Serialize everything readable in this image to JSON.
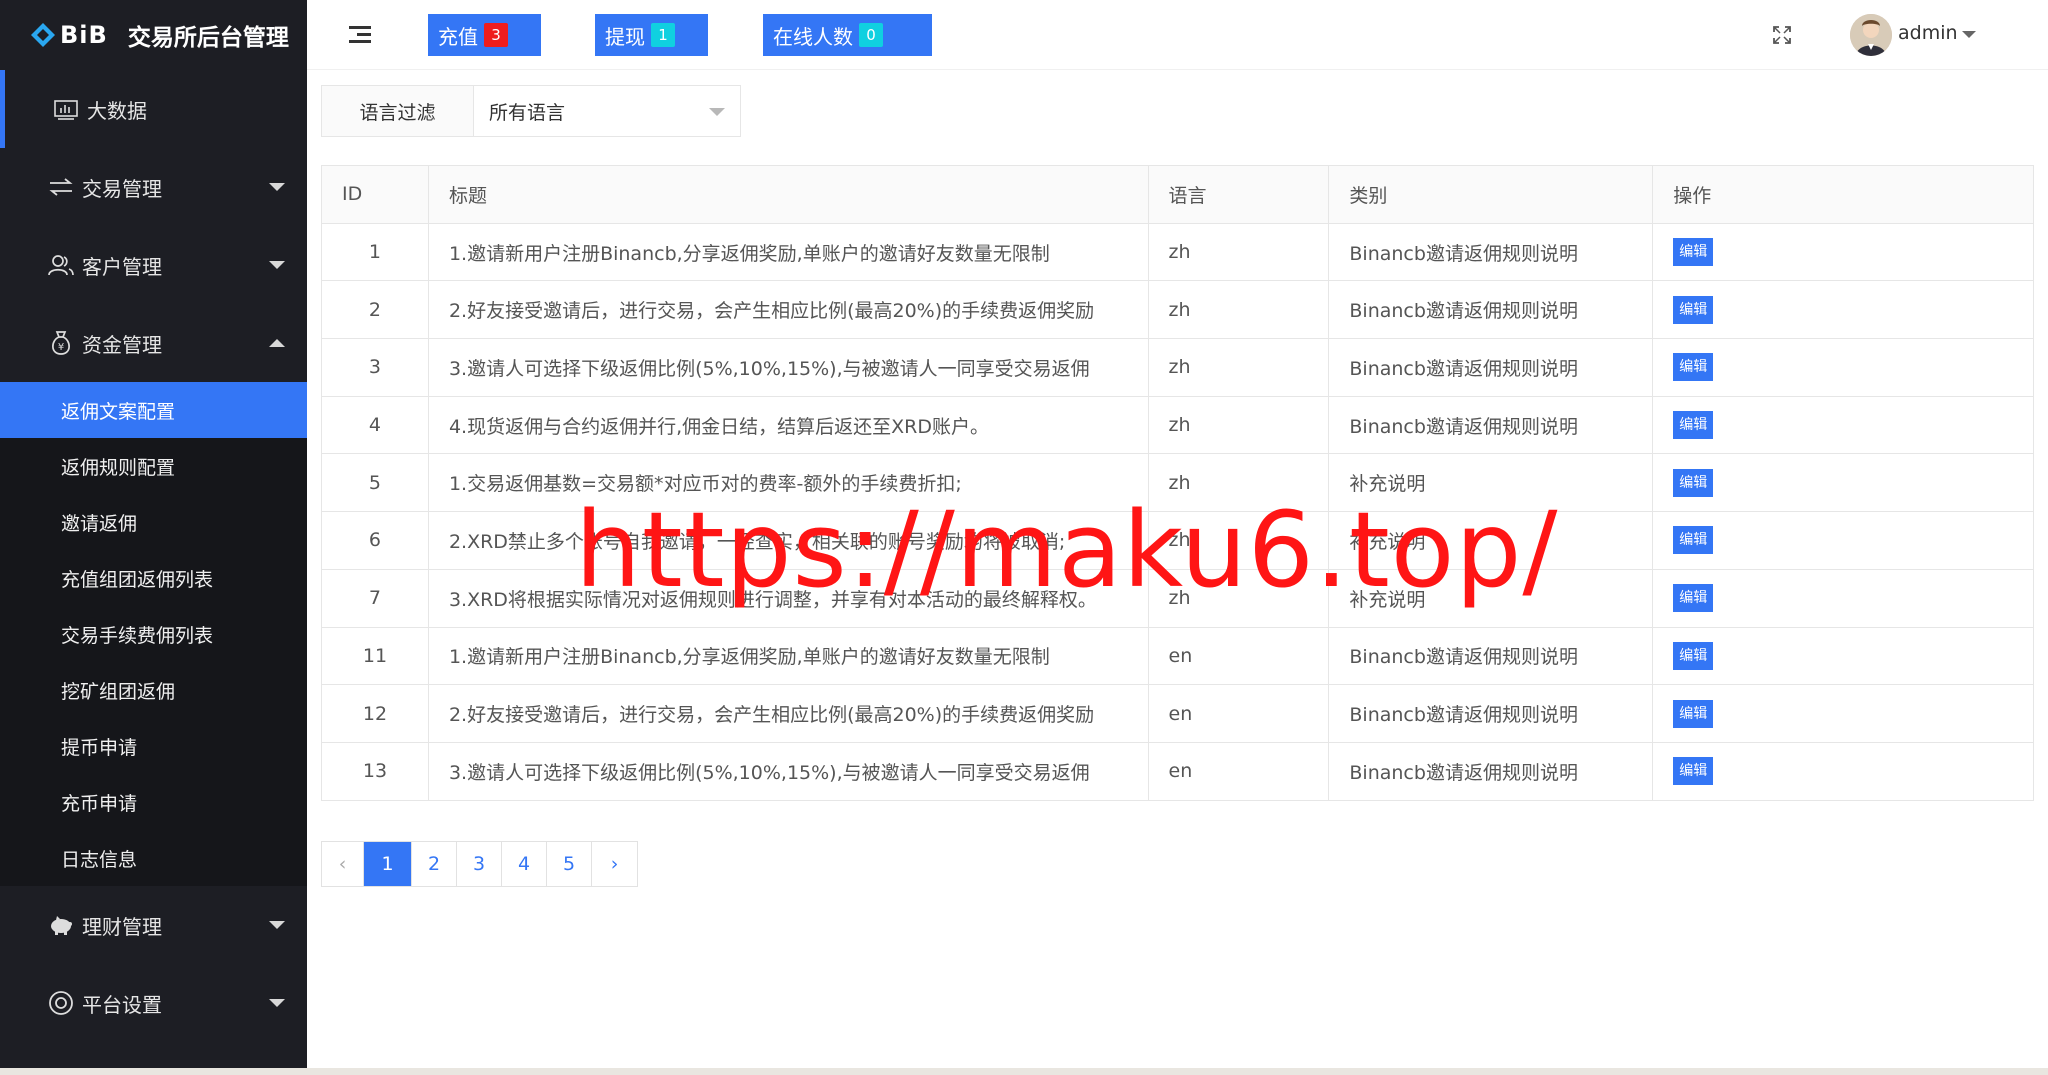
{
  "brand": {
    "logo_text": "BiB",
    "title": "交易所后台管理"
  },
  "sidebar": {
    "top_item": {
      "label": "大数据",
      "icon": "monitor-chart-icon"
    },
    "groups": [
      {
        "label": "交易管理",
        "icon": "exchange-arrows-icon",
        "expanded": false
      },
      {
        "label": "客户管理",
        "icon": "users-icon",
        "expanded": false
      },
      {
        "label": "资金管理",
        "icon": "money-bag-icon",
        "expanded": true
      },
      {
        "label": "理财管理",
        "icon": "piggy-bank-icon",
        "expanded": false
      },
      {
        "label": "平台设置",
        "icon": "settings-circle-icon",
        "expanded": false
      }
    ],
    "submenu": [
      {
        "label": "返佣文案配置",
        "active": true
      },
      {
        "label": "返佣规则配置",
        "active": false
      },
      {
        "label": "邀请返佣",
        "active": false
      },
      {
        "label": "充值组团返佣列表",
        "active": false
      },
      {
        "label": "交易手续费佣列表",
        "active": false
      },
      {
        "label": "挖矿组团返佣",
        "active": false
      },
      {
        "label": "提币申请",
        "active": false
      },
      {
        "label": "充币申请",
        "active": false
      },
      {
        "label": "日志信息",
        "active": false
      }
    ]
  },
  "topbar": {
    "buttons": [
      {
        "label": "充值",
        "count": "3",
        "badge_color": "#ef1d1d"
      },
      {
        "label": "提现",
        "count": "1",
        "badge_color": "#10d0e0"
      },
      {
        "label": "在线人数",
        "count": "0",
        "badge_color": "#10d0e0"
      }
    ],
    "user": "admin"
  },
  "filter": {
    "label": "语言过滤",
    "selected": "所有语言"
  },
  "table": {
    "headers": [
      "ID",
      "标题",
      "语言",
      "类别",
      "操作"
    ],
    "edit_label": "编辑",
    "rows": [
      {
        "id": "1",
        "title": "1.邀请新用户注册Binancb,分享返佣奖励,单账户的邀请好友数量无限制",
        "lang": "zh",
        "category": "Binancb邀请返佣规则说明"
      },
      {
        "id": "2",
        "title": "2.好友接受邀请后，进行交易，会产生相应比例(最高20%)的手续费返佣奖励",
        "lang": "zh",
        "category": "Binancb邀请返佣规则说明"
      },
      {
        "id": "3",
        "title": "3.邀请人可选择下级返佣比例(5%,10%,15%),与被邀请人一同享受交易返佣",
        "lang": "zh",
        "category": "Binancb邀请返佣规则说明"
      },
      {
        "id": "4",
        "title": "4.现货返佣与合约返佣并行,佣金日结，结算后返还至XRD账户。",
        "lang": "zh",
        "category": "Binancb邀请返佣规则说明"
      },
      {
        "id": "5",
        "title": "1.交易返佣基数=交易额*对应币对的费率-额外的手续费折扣;",
        "lang": "zh",
        "category": "补充说明"
      },
      {
        "id": "6",
        "title": "2.XRD禁止多个账号自我邀请，一经查实，相关联的账号奖励均将被取消;",
        "lang": "zh",
        "category": "补充说明"
      },
      {
        "id": "7",
        "title": "3.XRD将根据实际情况对返佣规则进行调整，并享有对本活动的最终解释权。",
        "lang": "zh",
        "category": "补充说明"
      },
      {
        "id": "11",
        "title": "1.邀请新用户注册Binancb,分享返佣奖励,单账户的邀请好友数量无限制",
        "lang": "en",
        "category": "Binancb邀请返佣规则说明"
      },
      {
        "id": "12",
        "title": "2.好友接受邀请后，进行交易，会产生相应比例(最高20%)的手续费返佣奖励",
        "lang": "en",
        "category": "Binancb邀请返佣规则说明"
      },
      {
        "id": "13",
        "title": "3.邀请人可选择下级返佣比例(5%,10%,15%),与被邀请人一同享受交易返佣",
        "lang": "en",
        "category": "Binancb邀请返佣规则说明"
      }
    ]
  },
  "pagination": {
    "prev": "‹",
    "next": "›",
    "pages": [
      "1",
      "2",
      "3",
      "4",
      "5"
    ],
    "current": "1"
  },
  "watermark": "https://maku6.top/",
  "colors": {
    "accent": "#3476f5",
    "sidebar_bg": "#1d1e24",
    "submenu_bg": "#15161a",
    "watermark": "#ff1515"
  }
}
